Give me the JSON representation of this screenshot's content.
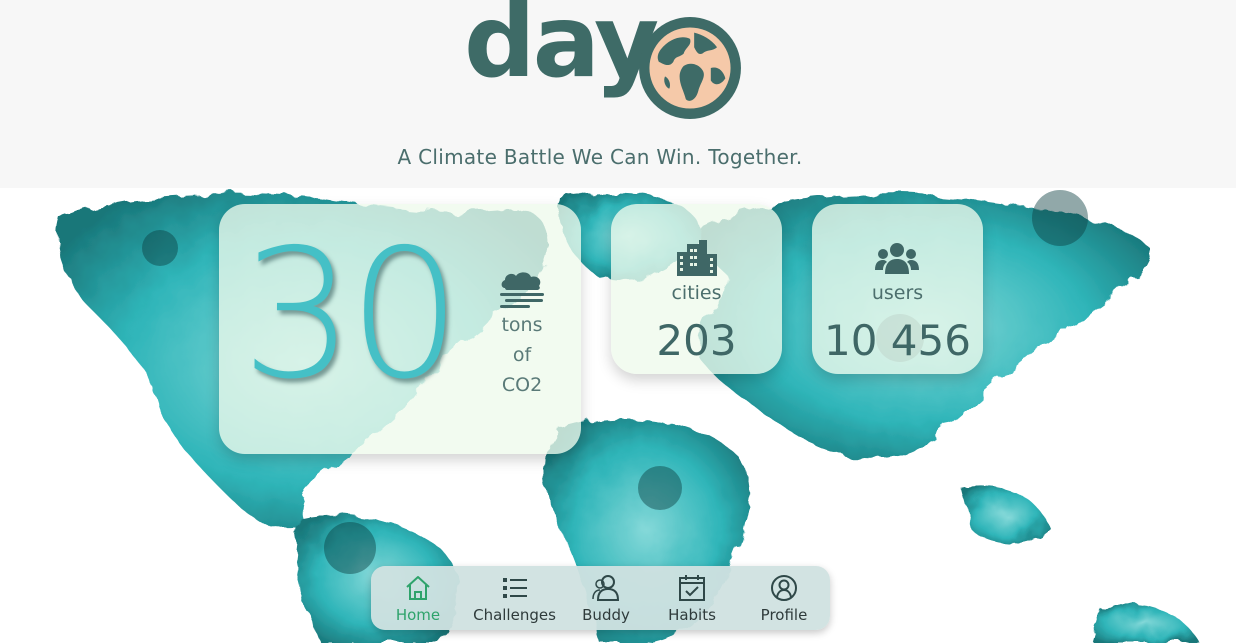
{
  "header": {
    "logo_text": "day",
    "tagline": "A Climate Battle We Can Win. Together."
  },
  "stats": {
    "co2": {
      "value": "30",
      "label_lines": [
        "tons",
        "of",
        "CO2"
      ],
      "icon": "cloud-smog-icon"
    },
    "cities": {
      "label": "cities",
      "value": "203",
      "icon": "city-icon"
    },
    "users": {
      "label": "users",
      "value": "10 456",
      "icon": "users-icon"
    }
  },
  "nav": {
    "items": [
      {
        "label": "Home",
        "icon": "home-icon",
        "active": true
      },
      {
        "label": "Challenges",
        "icon": "list-icon",
        "active": false
      },
      {
        "label": "Buddy",
        "icon": "buddy-icon",
        "active": false
      },
      {
        "label": "Habits",
        "icon": "calendar-check-icon",
        "active": false
      },
      {
        "label": "Profile",
        "icon": "profile-icon",
        "active": false
      }
    ]
  },
  "colors": {
    "brand": "#3e6b67",
    "globe_land": "#f5c9a9",
    "accent_teal": "#45c0c6",
    "active_nav": "#2ea36b"
  }
}
